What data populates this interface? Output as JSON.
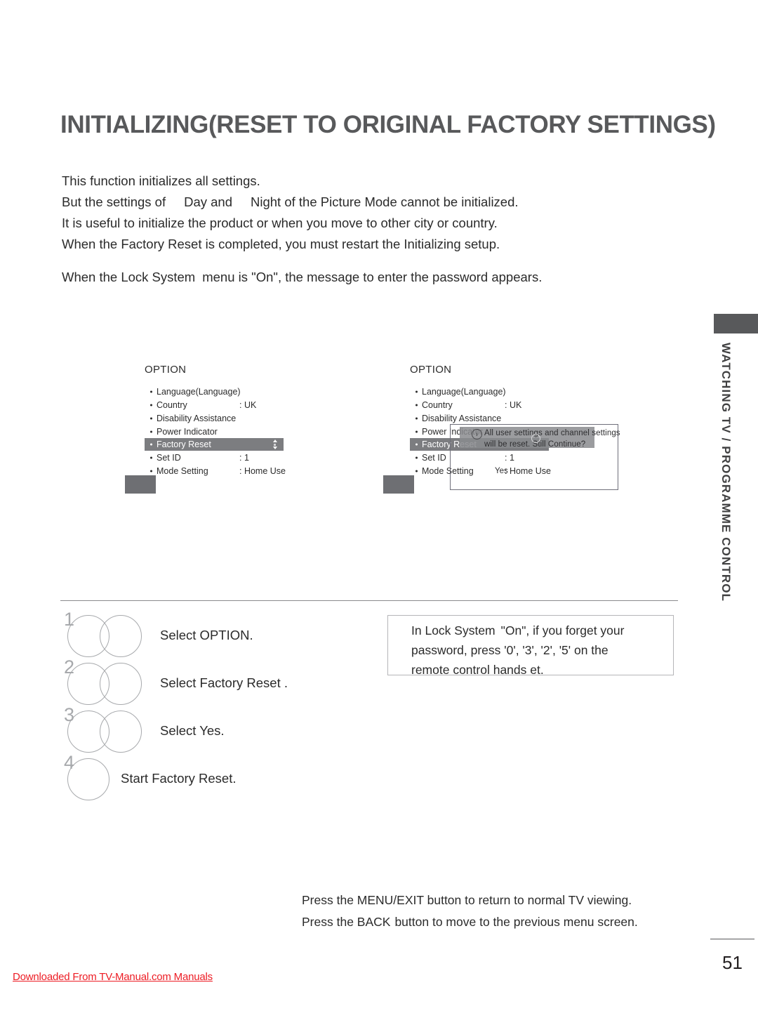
{
  "page": {
    "title": "INITIALIZING(RESET TO ORIGINAL FACTORY SETTINGS)",
    "number": "51",
    "side_tab": "WATCHING TV / PROGRAMME CONTROL",
    "watermark": "Downloaded From TV-Manual.com Manuals"
  },
  "intro": {
    "line1": "This function initializes all settings.",
    "line2_a": "But the settings of",
    "line2_b": "Day and",
    "line2_c": "Night of the Picture Mode  cannot be initialized.",
    "line3": "It is useful to initialize the product or when you move to other city or country.",
    "line4": "When the Factory Reset is completed, you must restart the Initializing setup.",
    "lock_note_a": "When the Lock System",
    "lock_note_b": "menu is \"On\", the message to enter the password appears."
  },
  "osd": {
    "title": "OPTION",
    "rows": [
      {
        "label": "Language(Language)",
        "value": ""
      },
      {
        "label": "Country",
        "value": ": UK"
      },
      {
        "label": "Disability Assistance",
        "value": ""
      },
      {
        "label": "Power Indicator",
        "value": ""
      },
      {
        "label": "Factory Reset",
        "value": ""
      },
      {
        "label": "Set ID",
        "value": ": 1"
      },
      {
        "label": "Mode Setting",
        "value": ": Home Use"
      }
    ],
    "highlight_index": 4
  },
  "dialog": {
    "info_glyph": "i",
    "message": "All user settings and channel settings will be reset. Still Continue?",
    "yes_label": "Yes"
  },
  "steps": [
    {
      "num": "1",
      "text": "Select OPTION.",
      "circles": 2
    },
    {
      "num": "2",
      "text": "Select Factory Reset .",
      "circles": 2
    },
    {
      "num": "3",
      "text": "Select Yes.",
      "circles": 2
    },
    {
      "num": "4",
      "text": "Start Factory Reset.",
      "circles": 1
    }
  ],
  "note": {
    "line1_a": "In Lock System",
    "line1_b": "\"On\", if you forget your",
    "line2": "password, press '0', '3', '2', '5' on the",
    "line3": "remote control hands et."
  },
  "footer": {
    "line1_a": "Press the MENU/EXIT button to return to normal TV viewing.",
    "line2_a": "Press the BACK",
    "line2_b": "button to move to the previous menu screen."
  },
  "colors": {
    "title_gray": "#58595b",
    "highlight_gray": "#7c7d80",
    "watermark_red": "#ed1c24"
  }
}
